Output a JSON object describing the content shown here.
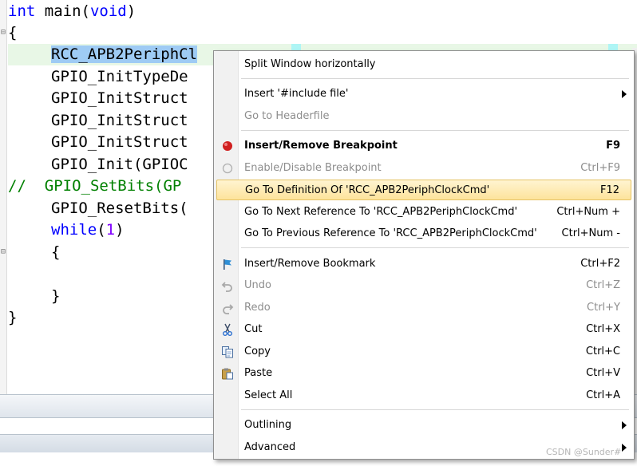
{
  "editor": {
    "lines": {
      "l1_kw": "int",
      "l1_rest": " main(",
      "l1_kw2": "void",
      "l1_end": ")",
      "l2": "{",
      "l3_sel": "RCC_APB2PeriphCl",
      "l4": "GPIO_InitTypeDe",
      "l5": "GPIO_InitStruct",
      "l6": "GPIO_InitStruct",
      "l7": "GPIO_InitStruct",
      "l8": "GPIO_Init(GPIOC",
      "l9_comment": "//  GPIO_SetBits(GP",
      "l10": "GPIO_ResetBits(",
      "l11_kw": "while",
      "l11_paren_open": "(",
      "l11_num": "1",
      "l11_paren_close": ")",
      "l12": "{",
      "l13": "}",
      "l14": "}"
    },
    "fold_markers": {
      "f1": "⊟",
      "f2": "⊟"
    }
  },
  "context_menu": {
    "items": [
      {
        "label": "Split Window horizontally",
        "shortcut": ""
      },
      {
        "label": "Insert '#include file'",
        "shortcut": ""
      },
      {
        "label": "Go to Headerfile",
        "shortcut": ""
      },
      {
        "label": "Insert/Remove Breakpoint",
        "shortcut": "F9"
      },
      {
        "label": "Enable/Disable Breakpoint",
        "shortcut": "Ctrl+F9"
      },
      {
        "label": "Go To Definition Of 'RCC_APB2PeriphClockCmd'",
        "shortcut": "F12"
      },
      {
        "label": "Go To Next Reference To 'RCC_APB2PeriphClockCmd'",
        "shortcut": "Ctrl+Num +"
      },
      {
        "label": "Go To Previous Reference To 'RCC_APB2PeriphClockCmd'",
        "shortcut": "Ctrl+Num -"
      },
      {
        "label": "Insert/Remove Bookmark",
        "shortcut": "Ctrl+F2"
      },
      {
        "label": "Undo",
        "shortcut": "Ctrl+Z"
      },
      {
        "label": "Redo",
        "shortcut": "Ctrl+Y"
      },
      {
        "label": "Cut",
        "shortcut": "Ctrl+X"
      },
      {
        "label": "Copy",
        "shortcut": "Ctrl+C"
      },
      {
        "label": "Paste",
        "shortcut": "Ctrl+V"
      },
      {
        "label": "Select All",
        "shortcut": "Ctrl+A"
      },
      {
        "label": "Outlining",
        "shortcut": ""
      },
      {
        "label": "Advanced",
        "shortcut": ""
      }
    ]
  },
  "watermark": "CSDN @Sunder#",
  "icons": {
    "breakpoint": "breakpoint-icon",
    "breakpoint_toggle": "breakpoint-toggle-icon",
    "bookmark": "bookmark-flag-icon",
    "undo": "undo-icon",
    "redo": "redo-icon",
    "cut": "scissors-icon",
    "copy": "copy-icon",
    "paste": "paste-icon"
  },
  "colors": {
    "selection": "#9ecbf4",
    "current_line": "#e8f7e6",
    "menu_highlight": "#fde39b",
    "keyword": "#0000ff",
    "comment": "#008000",
    "number": "#8000ff",
    "breakpoint_red": "#d02020"
  }
}
